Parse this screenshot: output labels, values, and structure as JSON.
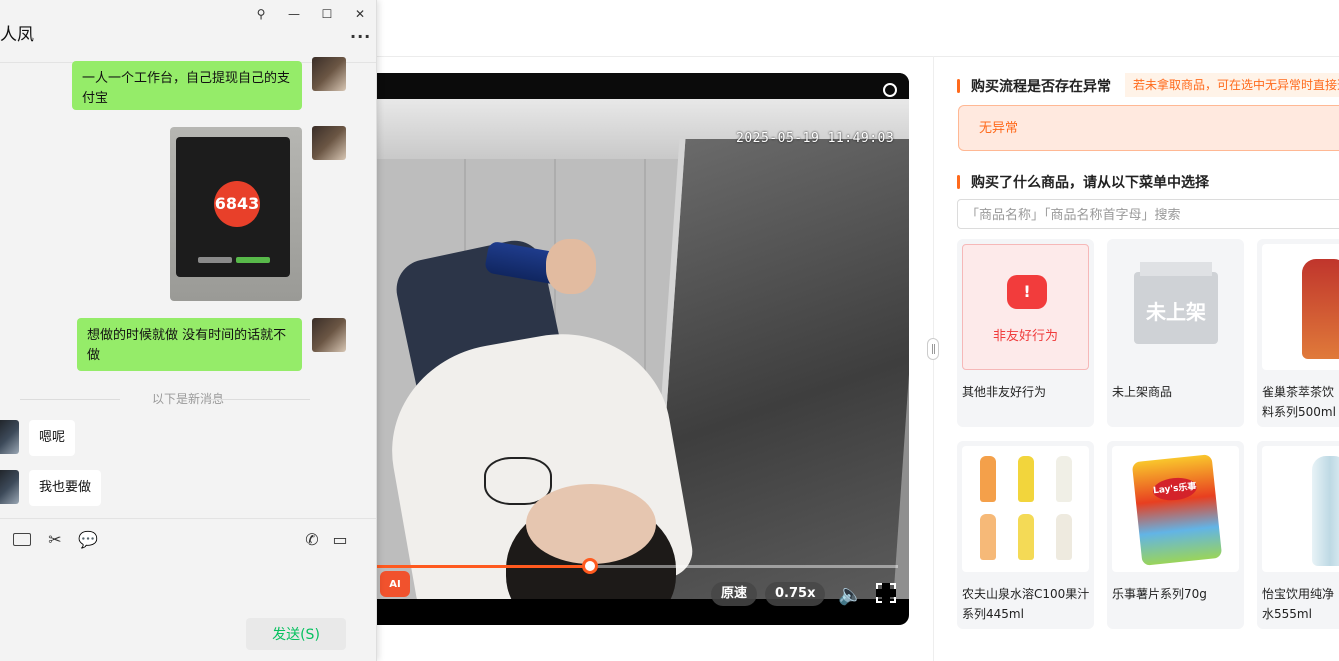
{
  "video": {
    "timestamp": "2025-05-19 11:49:03",
    "ai_label": "AI",
    "speed_mode_label": "原速",
    "speed_value_label": "0.75x",
    "progress_fraction": 0.41
  },
  "review": {
    "section_abnormal_title": "购买流程是否存在异常",
    "abnormal_hint": "若未拿取商品，可在选中无异常时直接选",
    "abnormal_option": "无异常",
    "section_products_title": "购买了什么商品，请从以下菜单中选择",
    "search_placeholder": "「商品名称」「商品名称首字母」搜索",
    "products": [
      {
        "label": "其他非友好行为",
        "image_text": "非友好行为",
        "icon": "warning-triangle-icon"
      },
      {
        "label": "未上架商品",
        "image_text": "未上架",
        "icon": "box-icon"
      },
      {
        "label": "雀巢茶萃茶饮料系列500ml",
        "icon": "tea-bottle-image"
      },
      {
        "label": "农夫山泉水溶C100果汁系列445ml",
        "icon": "juice-bottles-image"
      },
      {
        "label": "乐事薯片系列70g",
        "image_text": "Lay's乐事",
        "icon": "chips-bag-image"
      },
      {
        "label": "怡宝饮用纯净水555ml",
        "icon": "water-bottle-image"
      }
    ]
  },
  "chat": {
    "title": "人凤",
    "messages": {
      "m1": "一人一个工作台，自己提现自己的支付宝",
      "photo_code": "6843",
      "m3": "想做的时候就做  没有时间的话就不做",
      "separator": "以下是新消息",
      "m4": "嗯呢",
      "m5": "我也要做"
    },
    "send_label": "发送(S)"
  },
  "colors": {
    "accent": "#ff6a1c",
    "bubble_green": "#95ec69",
    "send_text": "#07c160",
    "progress": "#ff5a1f"
  }
}
